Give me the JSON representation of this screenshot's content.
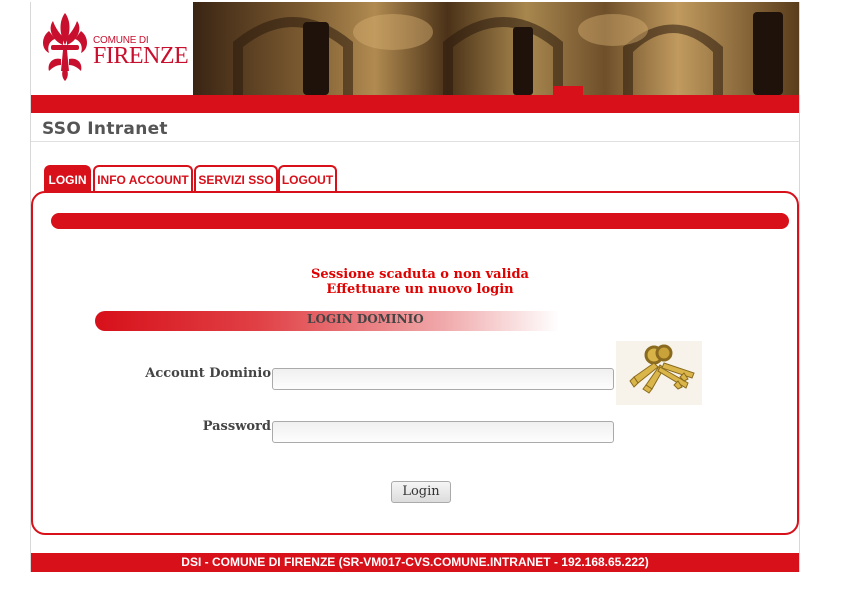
{
  "header": {
    "logo_small": "COMUNE DI",
    "logo_big": "FIRENZE",
    "app_title": "SSO Intranet"
  },
  "tabs": [
    {
      "label": "LOGIN",
      "active": true
    },
    {
      "label": "INFO ACCOUNT",
      "active": false
    },
    {
      "label": "SERVIZI SSO",
      "active": false
    },
    {
      "label": "LOGOUT",
      "active": false
    }
  ],
  "messages": {
    "line1": "Sessione scaduta o non valida",
    "line2": "Effettuare un nuovo login"
  },
  "login": {
    "section_title": "LOGIN DOMINIO",
    "account_label": "Account Dominio",
    "account_value": "",
    "password_label": "Password",
    "password_value": "",
    "submit_label": "Login"
  },
  "footer": {
    "text": "DSI - COMUNE DI FIRENZE (SR-VM017-CVS.COMUNE.INTRANET - 192.168.65.222)"
  },
  "colors": {
    "brand_red": "#d7101a",
    "message_red": "#e00000"
  },
  "icons": [
    "florence-lily-icon",
    "keys-icon"
  ]
}
